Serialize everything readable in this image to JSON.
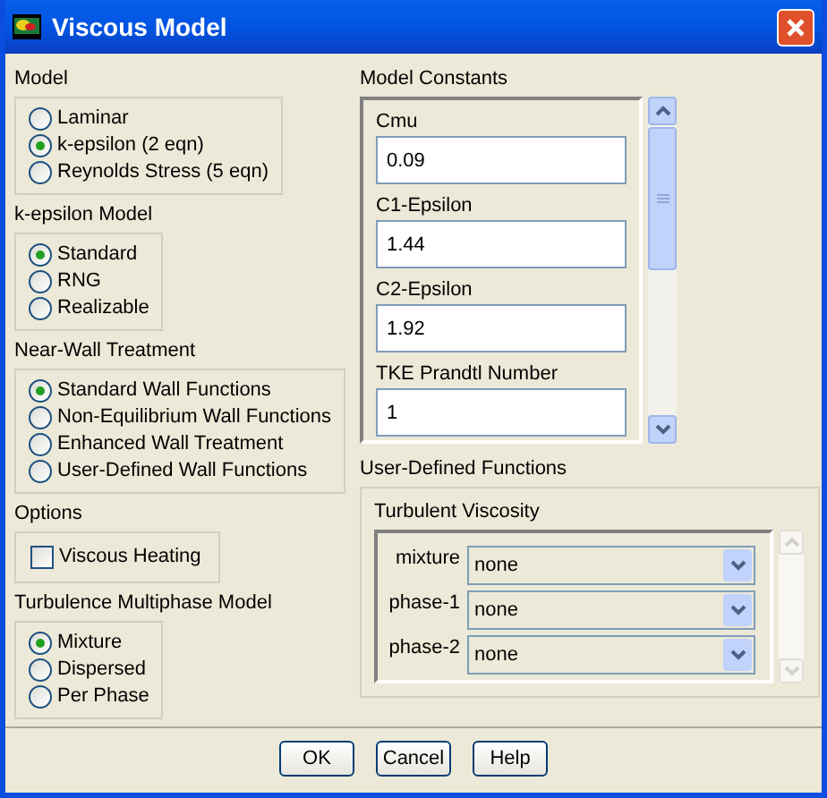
{
  "window": {
    "title": "Viscous Model"
  },
  "model": {
    "label": "Model",
    "options": [
      {
        "label": "Laminar",
        "selected": false
      },
      {
        "label": "k-epsilon (2 eqn)",
        "selected": true
      },
      {
        "label": "Reynolds Stress (5 eqn)",
        "selected": false
      }
    ]
  },
  "k_epsilon_model": {
    "label": "k-epsilon Model",
    "options": [
      {
        "label": "Standard",
        "selected": true
      },
      {
        "label": "RNG",
        "selected": false
      },
      {
        "label": "Realizable",
        "selected": false
      }
    ]
  },
  "near_wall_treatment": {
    "label": "Near-Wall Treatment",
    "options": [
      {
        "label": "Standard Wall Functions",
        "selected": true
      },
      {
        "label": "Non-Equilibrium Wall Functions",
        "selected": false
      },
      {
        "label": "Enhanced Wall Treatment",
        "selected": false
      },
      {
        "label": "User-Defined Wall Functions",
        "selected": false
      }
    ]
  },
  "options": {
    "label": "Options",
    "checkboxes": [
      {
        "label": "Viscous Heating",
        "checked": false
      }
    ]
  },
  "turbulence_multiphase_model": {
    "label": "Turbulence Multiphase Model",
    "options": [
      {
        "label": "Mixture",
        "selected": true
      },
      {
        "label": "Dispersed",
        "selected": false
      },
      {
        "label": "Per Phase",
        "selected": false
      }
    ]
  },
  "model_constants": {
    "label": "Model Constants",
    "fields": [
      {
        "label": "Cmu",
        "value": "0.09"
      },
      {
        "label": "C1-Epsilon",
        "value": "1.44"
      },
      {
        "label": "C2-Epsilon",
        "value": "1.92"
      },
      {
        "label": "TKE Prandtl Number",
        "value": "1"
      }
    ]
  },
  "user_defined_functions": {
    "label": "User-Defined Functions",
    "turbulent_viscosity": {
      "label": "Turbulent Viscosity",
      "rows": [
        {
          "label": "mixture",
          "value": "none"
        },
        {
          "label": "phase-1",
          "value": "none"
        },
        {
          "label": "phase-2",
          "value": "none"
        }
      ]
    }
  },
  "buttons": [
    "OK",
    "Cancel",
    "Help"
  ]
}
